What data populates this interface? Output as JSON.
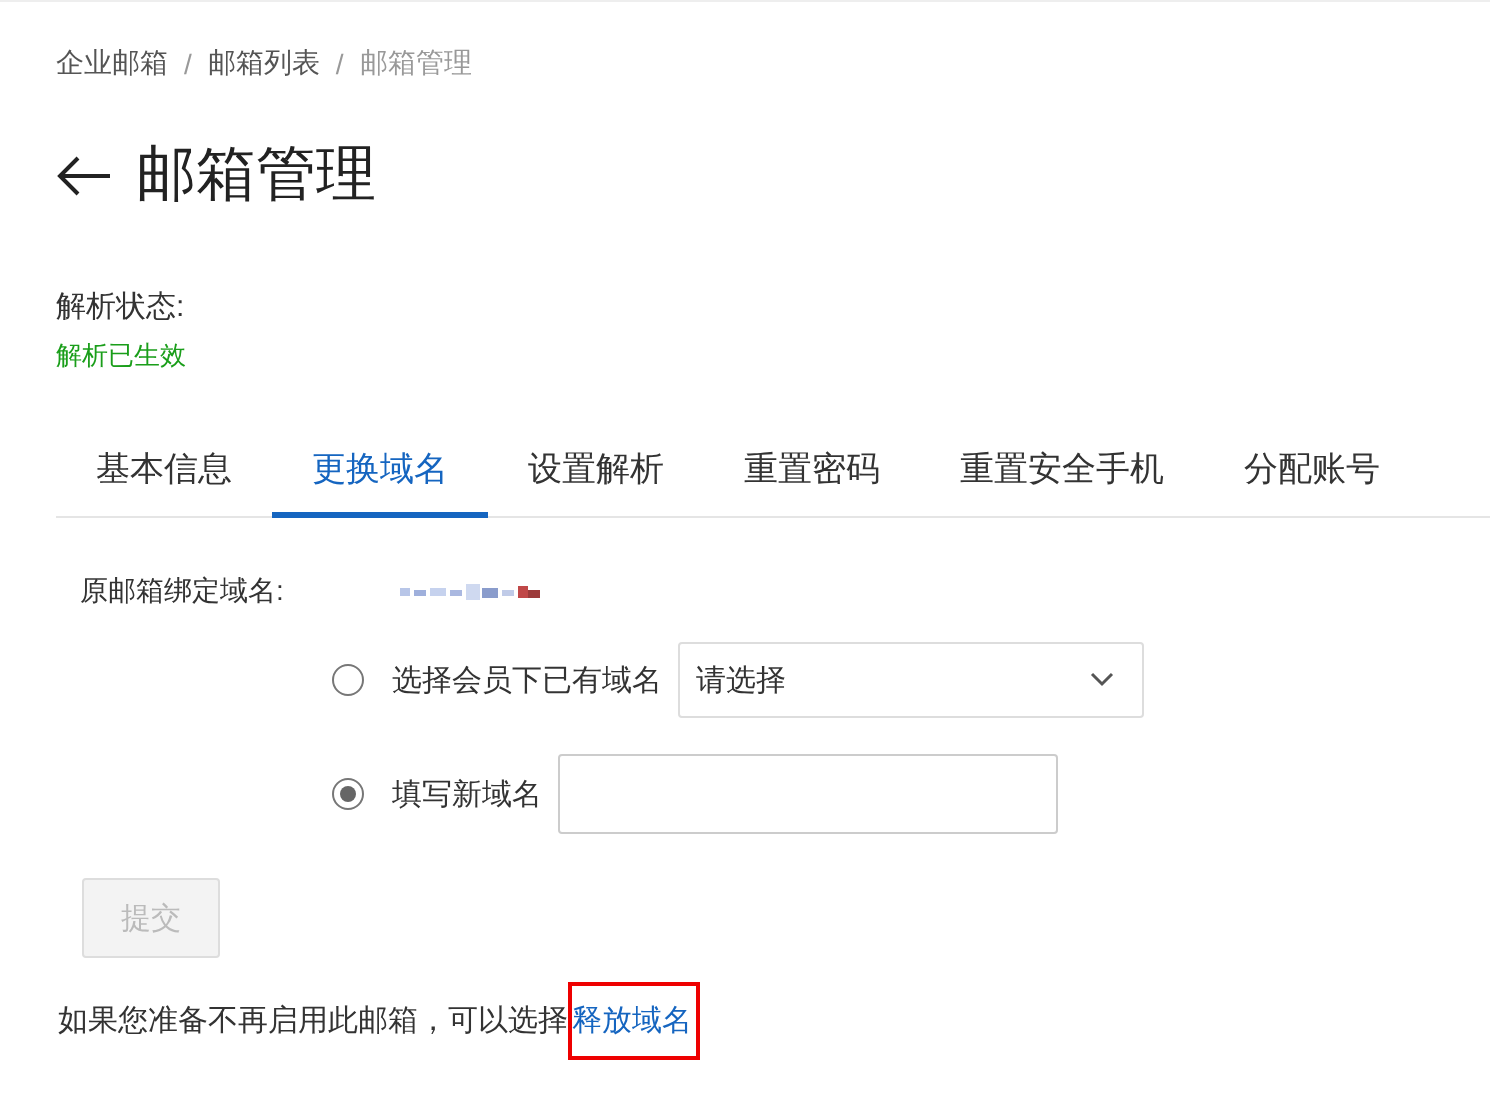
{
  "breadcrumb": [
    {
      "label": "企业邮箱",
      "current": false
    },
    {
      "label": "邮箱列表",
      "current": false
    },
    {
      "label": "邮箱管理",
      "current": true
    }
  ],
  "breadcrumb_separator": "/",
  "page_title": "邮箱管理",
  "status": {
    "label": "解析状态:",
    "value": "解析已生效"
  },
  "tabs": [
    {
      "label": "基本信息",
      "selected": false
    },
    {
      "label": "更换域名",
      "selected": true
    },
    {
      "label": "设置解析",
      "selected": false
    },
    {
      "label": "重置密码",
      "selected": false
    },
    {
      "label": "重置安全手机",
      "selected": false
    },
    {
      "label": "分配账号",
      "selected": false
    }
  ],
  "form": {
    "original_domain_label": "原邮箱绑定域名:",
    "options": [
      {
        "kind": "select",
        "label": "选择会员下已有域名",
        "selected": false,
        "placeholder": "请选择"
      },
      {
        "kind": "input",
        "label": "填写新域名",
        "selected": true
      }
    ],
    "submit": {
      "label": "提交",
      "disabled": true
    }
  },
  "footer": {
    "text": "如果您准备不再启用此邮箱，可以选择",
    "link": "释放域名",
    "highlighted": true
  }
}
